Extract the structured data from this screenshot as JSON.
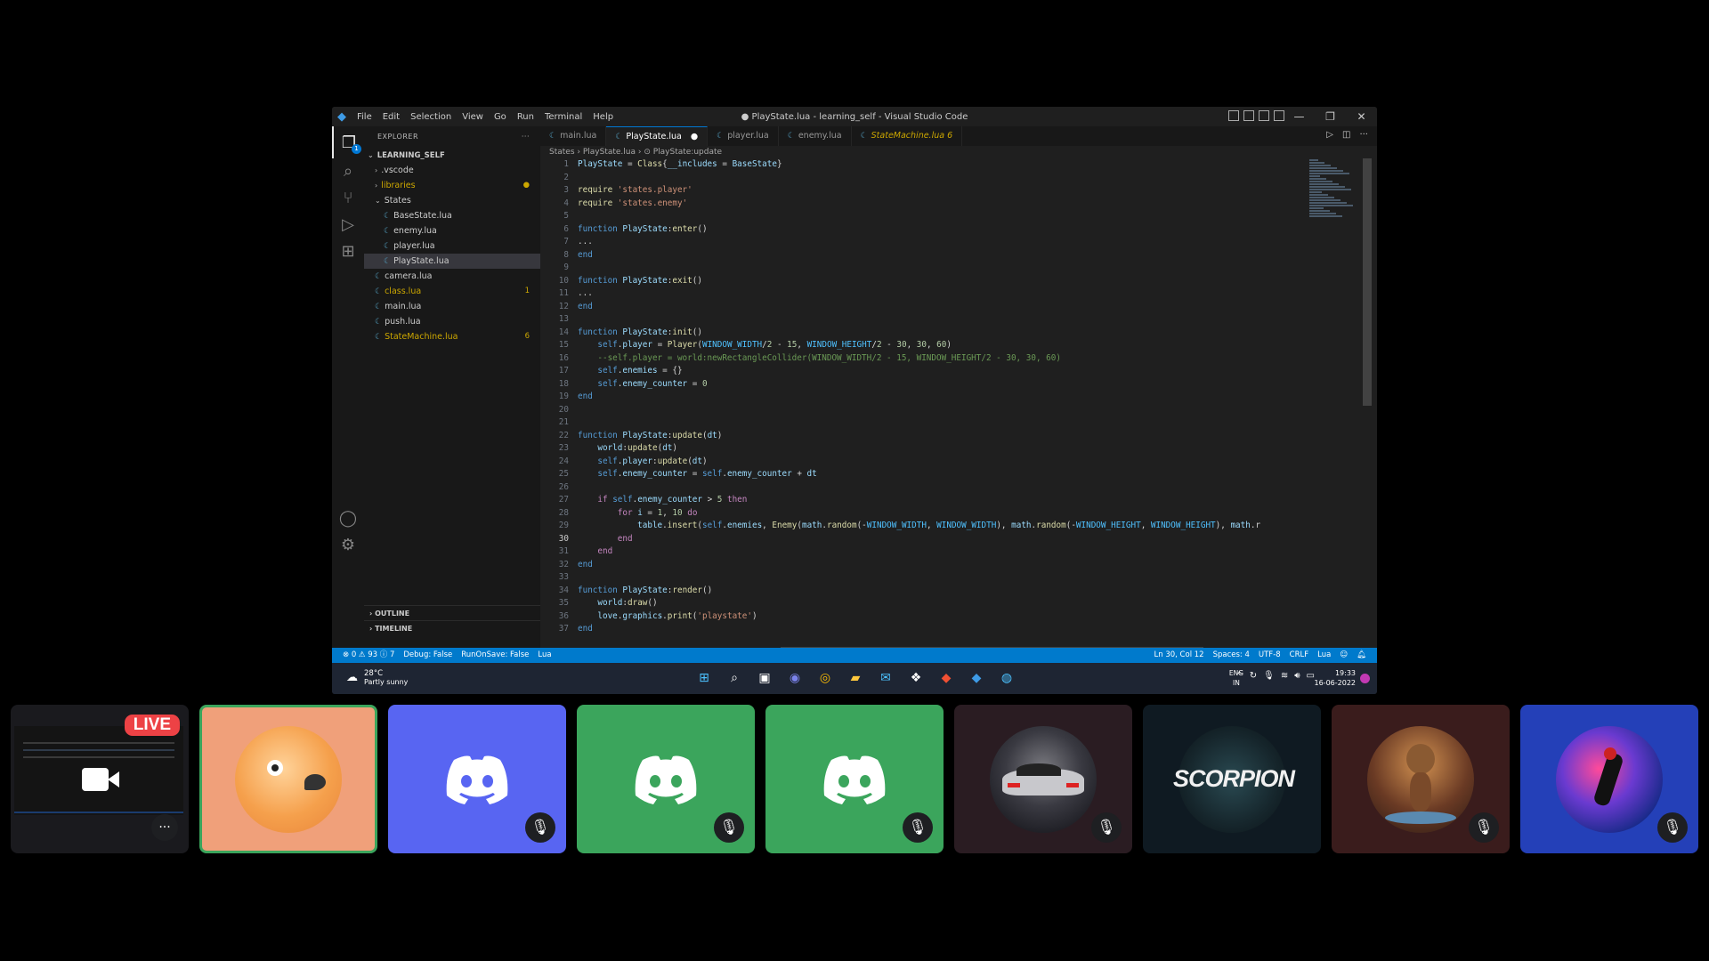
{
  "vscode": {
    "title": "● PlayState.lua - learning_self - Visual Studio Code",
    "menu": [
      "File",
      "Edit",
      "Selection",
      "View",
      "Go",
      "Run",
      "Terminal",
      "Help"
    ],
    "explorer_header": "EXPLORER",
    "explorer_dots": "···",
    "project": "LEARNING_SELF",
    "tree": [
      {
        "label": ".vscode",
        "type": "folder",
        "indent": 1,
        "color": "#cccccc",
        "badge": ""
      },
      {
        "label": "libraries",
        "type": "folder",
        "indent": 1,
        "color": "#cca700",
        "badge": "●"
      },
      {
        "label": "States",
        "type": "folder-open",
        "indent": 1,
        "color": "#cccccc",
        "badge": ""
      },
      {
        "label": "BaseState.lua",
        "type": "file",
        "indent": 2,
        "color": "#cccccc",
        "badge": ""
      },
      {
        "label": "enemy.lua",
        "type": "file",
        "indent": 2,
        "color": "#cccccc",
        "badge": ""
      },
      {
        "label": "player.lua",
        "type": "file",
        "indent": 2,
        "color": "#cccccc",
        "badge": ""
      },
      {
        "label": "PlayState.lua",
        "type": "file",
        "indent": 2,
        "color": "#cccccc",
        "badge": "",
        "selected": true
      },
      {
        "label": "camera.lua",
        "type": "file",
        "indent": 1,
        "color": "#cccccc",
        "badge": ""
      },
      {
        "label": "class.lua",
        "type": "file",
        "indent": 1,
        "color": "#cca700",
        "badge": "1"
      },
      {
        "label": "main.lua",
        "type": "file",
        "indent": 1,
        "color": "#cccccc",
        "badge": ""
      },
      {
        "label": "push.lua",
        "type": "file",
        "indent": 1,
        "color": "#cccccc",
        "badge": ""
      },
      {
        "label": "StateMachine.lua",
        "type": "file",
        "indent": 1,
        "color": "#cca700",
        "badge": "6"
      }
    ],
    "outline": "OUTLINE",
    "timeline": "TIMELINE",
    "tabs": [
      {
        "label": "main.lua",
        "active": false,
        "warn": false,
        "dirty": ""
      },
      {
        "label": "PlayState.lua",
        "active": true,
        "warn": false,
        "dirty": "●"
      },
      {
        "label": "player.lua",
        "active": false,
        "warn": false,
        "dirty": ""
      },
      {
        "label": "enemy.lua",
        "active": false,
        "warn": false,
        "dirty": ""
      },
      {
        "label": "StateMachine.lua  6",
        "active": false,
        "warn": true,
        "dirty": ""
      }
    ],
    "breadcrumb": "States  ›  PlayState.lua  ›  ⊙ PlayState:update",
    "code": [
      "<span class='var'>PlayState</span> = <span class='fn'>Class</span>{<span class='var'>__includes</span> = <span class='var'>BaseState</span>}",
      "",
      "<span class='fn'>require</span> <span class='str'>'states.player'</span>",
      "<span class='fn'>require</span> <span class='str'>'states.enemy'</span>",
      "",
      "<span class='kw'>function</span> <span class='var'>PlayState</span>:<span class='fn'>enter</span>()",
      "...",
      "<span class='kw'>end</span>",
      "",
      "<span class='kw'>function</span> <span class='var'>PlayState</span>:<span class='fn'>exit</span>()",
      "...",
      "<span class='kw'>end</span>",
      "",
      "<span class='kw'>function</span> <span class='var'>PlayState</span>:<span class='fn'>init</span>()",
      "    <span class='kw'>self</span>.<span class='var'>player</span> = <span class='fn'>Player</span>(<span class='cnst'>WINDOW_WIDTH</span>/<span class='num'>2</span> - <span class='num'>15</span>, <span class='cnst'>WINDOW_HEIGHT</span>/<span class='num'>2</span> - <span class='num'>30</span>, <span class='num'>30</span>, <span class='num'>60</span>)",
      "    <span class='cmt'>--self.player = world:newRectangleCollider(WINDOW_WIDTH/2 - 15, WINDOW_HEIGHT/2 - 30, 30, 60)</span>",
      "    <span class='kw'>self</span>.<span class='var'>enemies</span> = {}",
      "    <span class='kw'>self</span>.<span class='var'>enemy_counter</span> = <span class='num'>0</span>",
      "<span class='kw'>end</span>",
      "",
      "",
      "<span class='kw'>function</span> <span class='var'>PlayState</span>:<span class='fn'>update</span>(<span class='var'>dt</span>)",
      "    <span class='var'>world</span>:<span class='fn'>update</span>(<span class='var'>dt</span>)",
      "    <span class='kw'>self</span>.<span class='var'>player</span>:<span class='fn'>update</span>(<span class='var'>dt</span>)",
      "    <span class='kw'>self</span>.<span class='var'>enemy_counter</span> = <span class='kw'>self</span>.<span class='var'>enemy_counter</span> + <span class='var'>dt</span>",
      "",
      "    <span class='kw2'>if</span> <span class='kw'>self</span>.<span class='var'>enemy_counter</span> &gt; <span class='num'>5</span> <span class='kw2'>then</span>",
      "        <span class='kw2'>for</span> <span class='var'>i</span> = <span class='num'>1</span>, <span class='num'>10</span> <span class='kw2'>do</span>",
      "            <span class='var'>table</span>.<span class='fn'>insert</span>(<span class='kw'>self</span>.<span class='var'>enemies</span>, <span class='fn'>Enemy</span>(<span class='var'>math</span>.<span class='fn'>random</span>(-<span class='cnst'>WINDOW_WIDTH</span>, <span class='cnst'>WINDOW_WIDTH</span>), <span class='var'>math</span>.<span class='fn'>random</span>(-<span class='cnst'>WINDOW_HEIGHT</span>, <span class='cnst'>WINDOW_HEIGHT</span>), <span class='var'>math</span>.r",
      "        <span class='kw2'>end</span>",
      "    <span class='kw2'>end</span>",
      "<span class='kw'>end</span>",
      "",
      "<span class='kw'>function</span> <span class='var'>PlayState</span>:<span class='fn'>render</span>()",
      "    <span class='var'>world</span>:<span class='fn'>draw</span>()",
      "    <span class='var'>love</span>.<span class='var'>graphics</span>.<span class='fn'>print</span>(<span class='str'>'playstate'</span>)",
      "<span class='kw'>end</span>"
    ],
    "current_line": 30,
    "status_left": [
      "⊗ 0  ⚠ 93  ⓘ 7",
      "Debug: False",
      "RunOnSave: False",
      "Lua"
    ],
    "status_right": [
      "Ln 30, Col 12",
      "Spaces: 4",
      "UTF-8",
      "CRLF",
      "Lua"
    ]
  },
  "taskbar": {
    "temp": "28°C",
    "weather": "Partly sunny",
    "lang1": "ENG",
    "lang2": "IN",
    "time": "19:33",
    "date": "16-06-2022"
  },
  "call": {
    "live_label": "LIVE",
    "more_label": "···",
    "scorpion_label": "SCORPION"
  },
  "colors": {
    "discord_blurple": "#5865f2",
    "discord_green": "#3ba55c",
    "speaking_ring": "#3ba55c",
    "live_red": "#ed4245"
  }
}
